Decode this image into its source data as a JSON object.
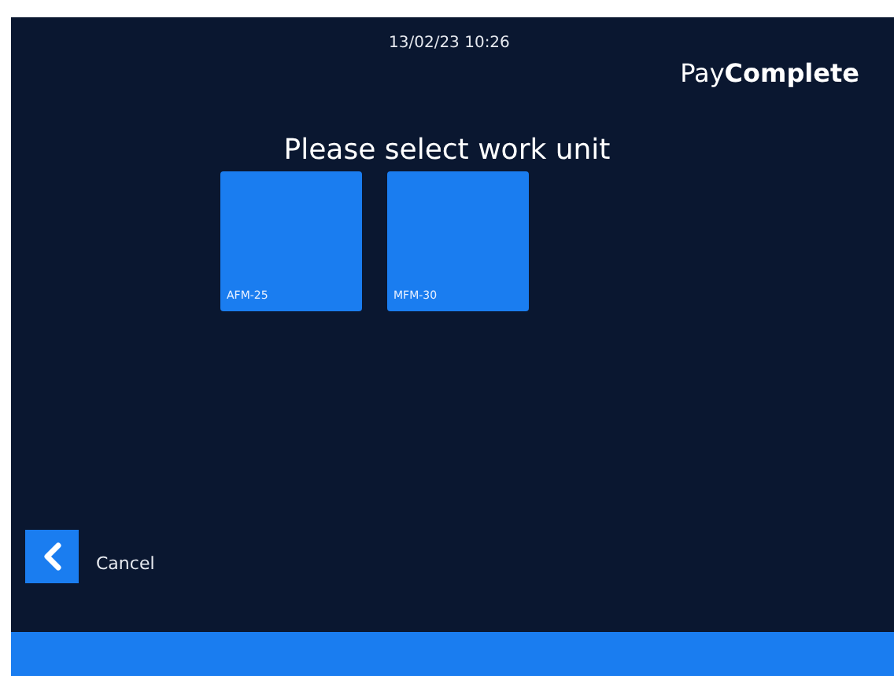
{
  "header": {
    "datetime": "13/02/23 10:26",
    "logo": {
      "light": "Pay",
      "bold": "Complete"
    }
  },
  "title": "Please select work unit",
  "work_units": [
    {
      "label": "AFM-25"
    },
    {
      "label": "MFM-30"
    }
  ],
  "cancel": {
    "label": "Cancel"
  }
}
